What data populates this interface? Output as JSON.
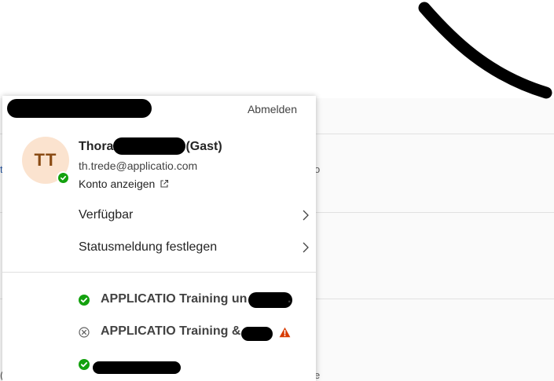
{
  "account_menu": {
    "tenant_name": "...",
    "sign_out_label": "Abmelden",
    "user": {
      "initials": "TT",
      "display_name": "Thora",
      "display_name_suffix": "(Gast)",
      "email": "th.trede@applicatio.com",
      "view_account_label": "Konto anzeigen",
      "presence": "available"
    },
    "menu_items": [
      {
        "label": "Verfügbar"
      },
      {
        "label": "Statusmeldung festlegen"
      }
    ],
    "other_accounts": [
      {
        "name": "APPLICATIO Training un",
        "status": "signed-in",
        "warning": false
      },
      {
        "name": "APPLICATIO Training & ",
        "status": "signed-out",
        "warning": true
      },
      {
        "name": "",
        "status": "signed-in",
        "warning": false
      }
    ]
  },
  "colors": {
    "available_green": "#13a10e",
    "warning_orange": "#d83b01",
    "avatar_background": "#fbe3cf",
    "avatar_text": "#8a4b14"
  }
}
